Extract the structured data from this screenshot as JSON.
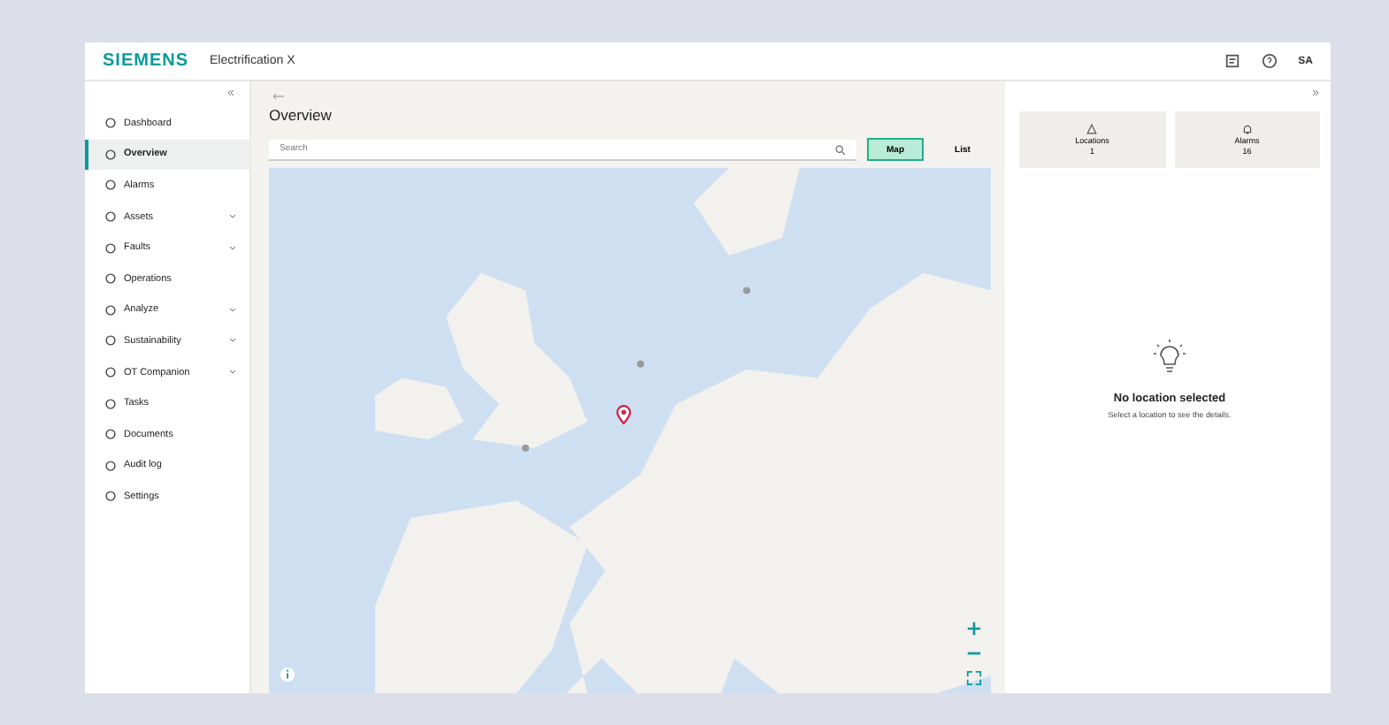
{
  "header": {
    "brand": "SIEMENS",
    "app_name": "Electrification X",
    "user_initials": "SA"
  },
  "sidebar": {
    "items": [
      {
        "label": "Dashboard",
        "kind": "link",
        "selected": false
      },
      {
        "label": "Overview",
        "kind": "link",
        "selected": true
      },
      {
        "label": "Alarms",
        "kind": "link",
        "selected": false
      },
      {
        "label": "Assets",
        "kind": "group",
        "selected": false
      },
      {
        "label": "Faults",
        "kind": "group",
        "selected": false
      },
      {
        "label": "Operations",
        "kind": "link",
        "selected": false
      },
      {
        "label": "Analyze",
        "kind": "group",
        "selected": false
      },
      {
        "label": "Sustainability",
        "kind": "group",
        "selected": false
      },
      {
        "label": "OT Companion",
        "kind": "group",
        "selected": false
      },
      {
        "label": "Tasks",
        "kind": "link",
        "selected": false
      },
      {
        "label": "Documents",
        "kind": "link",
        "selected": false
      },
      {
        "label": "Audit log",
        "kind": "link",
        "selected": false
      },
      {
        "label": "Settings",
        "kind": "link",
        "selected": false
      }
    ]
  },
  "main": {
    "title": "Overview",
    "search": {
      "placeholder": "Search"
    },
    "view_toggle": [
      {
        "label": "Map",
        "selected": true
      },
      {
        "label": "List",
        "selected": false
      }
    ]
  },
  "panel": {
    "cards": [
      {
        "label": "Locations",
        "value": "1",
        "kind": "locations"
      },
      {
        "label": "Alarms",
        "value": "16",
        "kind": "alarms"
      }
    ],
    "empty_title": "No location selected",
    "empty_text": "Select a location to see the details."
  }
}
